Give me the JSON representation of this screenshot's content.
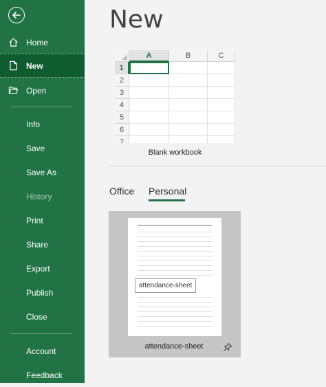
{
  "sidebar": {
    "back_icon": "back-arrow-icon",
    "items": [
      {
        "id": "home",
        "label": "Home",
        "icon": "home-icon"
      },
      {
        "id": "new",
        "label": "New",
        "icon": "new-document-icon"
      },
      {
        "id": "open",
        "label": "Open",
        "icon": "open-folder-icon"
      },
      {
        "id": "info",
        "label": "Info"
      },
      {
        "id": "save",
        "label": "Save"
      },
      {
        "id": "save-as",
        "label": "Save As"
      },
      {
        "id": "history",
        "label": "History"
      },
      {
        "id": "print",
        "label": "Print"
      },
      {
        "id": "share",
        "label": "Share"
      },
      {
        "id": "export",
        "label": "Export"
      },
      {
        "id": "publish",
        "label": "Publish"
      },
      {
        "id": "close",
        "label": "Close"
      },
      {
        "id": "account",
        "label": "Account"
      },
      {
        "id": "feedback",
        "label": "Feedback"
      }
    ]
  },
  "main": {
    "title": "New",
    "blank_workbook": {
      "label": "Blank workbook",
      "columns": [
        "A",
        "B",
        "C"
      ],
      "rows": [
        "1",
        "2",
        "3",
        "4",
        "5",
        "6",
        "7"
      ]
    },
    "tabs": [
      {
        "label": "Office",
        "selected": false
      },
      {
        "label": "Personal",
        "selected": true
      }
    ],
    "template": {
      "name": "attendance-sheet",
      "tooltip": "attendance-sheet",
      "pin_icon": "pin-icon"
    }
  },
  "colors": {
    "sidebar_bg": "#217346",
    "active_bg": "#0e5c2f",
    "accent": "#217346"
  }
}
